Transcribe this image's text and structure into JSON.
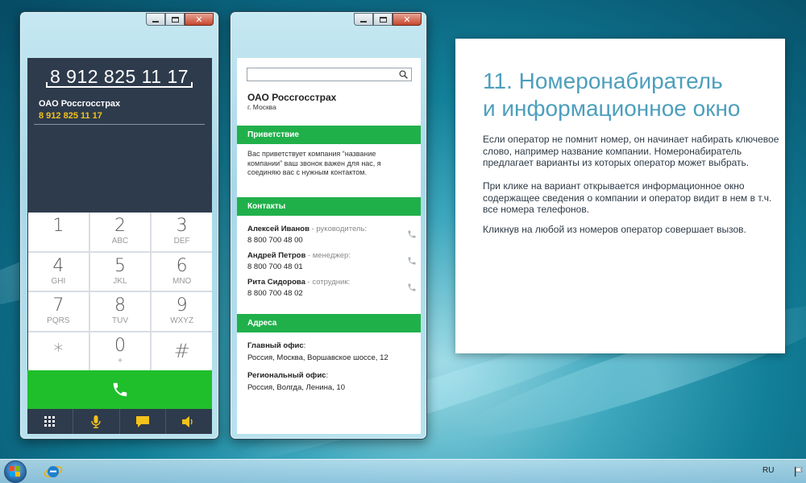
{
  "dialer": {
    "number": "8 912 825 11 17",
    "contact_name": "ОАО Россгосстрах",
    "contact_number": "8 912 825 11 17",
    "keys": [
      {
        "digit": "1",
        "letters": ""
      },
      {
        "digit": "2",
        "letters": "ABC"
      },
      {
        "digit": "3",
        "letters": "DEF"
      },
      {
        "digit": "4",
        "letters": "GHI"
      },
      {
        "digit": "5",
        "letters": "JKL"
      },
      {
        "digit": "6",
        "letters": "MNO"
      },
      {
        "digit": "7",
        "letters": "PQRS"
      },
      {
        "digit": "8",
        "letters": "TUV"
      },
      {
        "digit": "9",
        "letters": "WXYZ"
      },
      {
        "digit": "*",
        "letters": ""
      },
      {
        "digit": "0",
        "letters": "+"
      },
      {
        "digit": "#",
        "letters": ""
      }
    ],
    "bottom_icons": [
      "keypad-icon",
      "microphone-icon",
      "message-icon",
      "speaker-icon"
    ],
    "colors": {
      "panel": "#2e3b4c",
      "call": "#1fbf2b",
      "accent": "#f3c21b"
    }
  },
  "info": {
    "search_placeholder": "",
    "company": "ОАО Россгосстрах",
    "city": "г. Москва",
    "sections": {
      "greeting": "Приветствие",
      "contacts": "Контакты",
      "addresses": "Адреса"
    },
    "greeting_text": "Вас приветствует компания  “название компании” ваш звонок важен для нас, я соединяю вас с нужным контактом.",
    "contacts": [
      {
        "name": "Алексей Иванов",
        "role": " - руководитель:",
        "phone": "8 800 700 48 00"
      },
      {
        "name": "Андрей Петров",
        "role": " - менеджер:",
        "phone": "8 800 700 48 01"
      },
      {
        "name": "Рита Сидорова",
        "role": " - сотрудник:",
        "phone": "8 800 700 48 02"
      }
    ],
    "addresses": [
      {
        "title": "Главный офис",
        "sep": ":",
        "value": "Россия, Москва, Воршавское шоссе, 12"
      },
      {
        "title": "Региональный офис",
        "sep": ":",
        "value": "Россия, Волгда, Ленина, 10"
      }
    ],
    "colors": {
      "section": "#20b04a"
    }
  },
  "slide": {
    "title_line1": "11. Номеронабиратель",
    "title_line2": "и информационное окно",
    "paragraphs": [
      "Если оператор не помнит номер, он начинает набирать ключевое слово, например название компании. Номеронабиратель предлагает варианты из которых оператор может выбрать.",
      "При клике на вариант открывается информационное окно содержащее сведения о компании и оператор видит в нем в т.ч. все номера телефонов.",
      "Кликнув на любой из номеров оператор совершает вызов."
    ],
    "colors": {
      "title": "#4d9fbd"
    }
  },
  "taskbar": {
    "language": "RU"
  }
}
